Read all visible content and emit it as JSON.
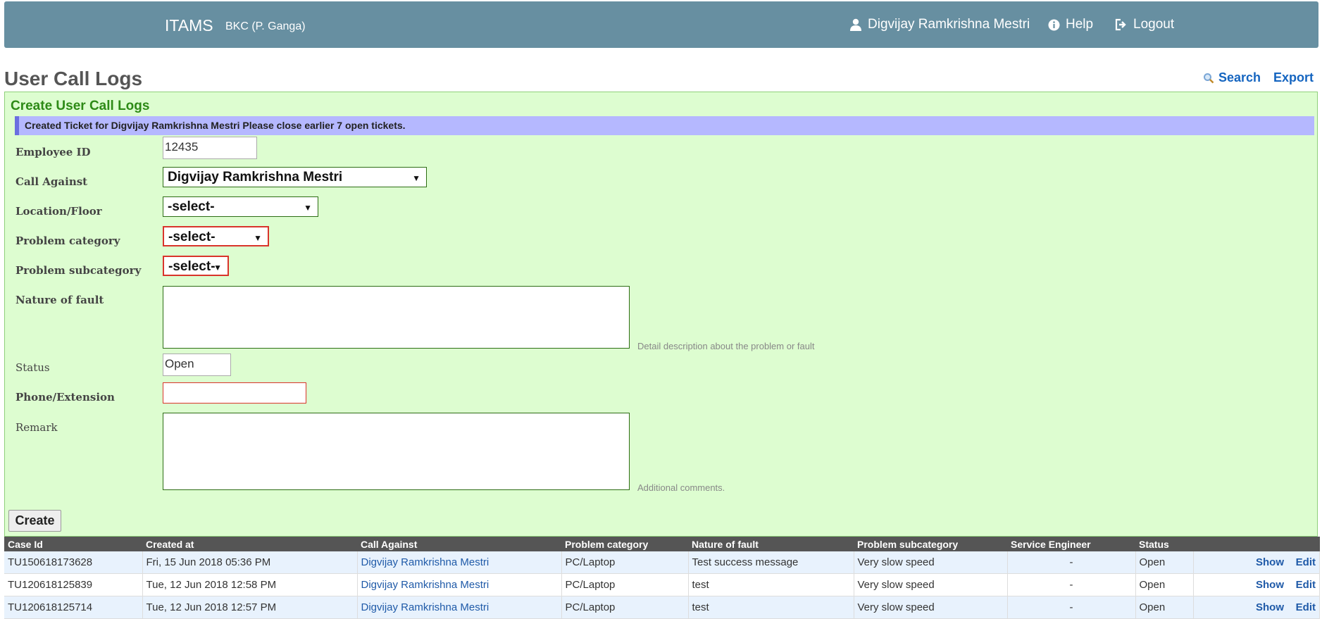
{
  "nav": {
    "brand": "ITAMS",
    "branch": "BKC (P. Ganga)",
    "user_name": "Digvijay Ramkrishna Mestri",
    "help_label": "Help",
    "logout_label": "Logout"
  },
  "page": {
    "title": "User Call Logs",
    "search_label": "Search",
    "export_label": "Export"
  },
  "form": {
    "title": "Create User Call Logs",
    "flash": "Created Ticket for Digvijay Ramkrishna Mestri Please close earlier 7 open tickets.",
    "employee_id_label": "Employee ID",
    "employee_id_value": "12435",
    "call_against_label": "Call Against",
    "call_against_value": "Digvijay Ramkrishna Mestri",
    "location_label": "Location/Floor",
    "location_value": "-select-",
    "problem_category_label": "Problem category",
    "problem_category_value": "-select-",
    "problem_subcategory_label": "Problem subcategory",
    "problem_subcategory_value": "-select-",
    "nature_label": "Nature of fault",
    "nature_hint": "Detail description about the problem or fault",
    "status_label": "Status",
    "status_value": "Open",
    "phone_label": "Phone/Extension",
    "remark_label": "Remark",
    "remark_hint": "Additional comments.",
    "create_label": "Create"
  },
  "table": {
    "headers": [
      "Case Id",
      "Created at",
      "Call Against",
      "Problem category",
      "Nature of fault",
      "Problem subcategory",
      "Service Engineer",
      "Status"
    ],
    "show_label": "Show",
    "edit_label": "Edit",
    "rows": [
      {
        "case_id": "TU150618173628",
        "created_at": "Fri, 15 Jun 2018 05:36 PM",
        "call_against": "Digvijay Ramkrishna Mestri",
        "category": "PC/Laptop",
        "nature": "Test success message",
        "subcategory": "Very slow speed",
        "engineer": "-",
        "status": "Open"
      },
      {
        "case_id": "TU120618125839",
        "created_at": "Tue, 12 Jun 2018 12:58 PM",
        "call_against": "Digvijay Ramkrishna Mestri",
        "category": "PC/Laptop",
        "nature": "test",
        "subcategory": "Very slow speed",
        "engineer": "-",
        "status": "Open"
      },
      {
        "case_id": "TU120618125714",
        "created_at": "Tue, 12 Jun 2018 12:57 PM",
        "call_against": "Digvijay Ramkrishna Mestri",
        "category": "PC/Laptop",
        "nature": "test",
        "subcategory": "Very slow speed",
        "engineer": "-",
        "status": "Open"
      }
    ]
  }
}
